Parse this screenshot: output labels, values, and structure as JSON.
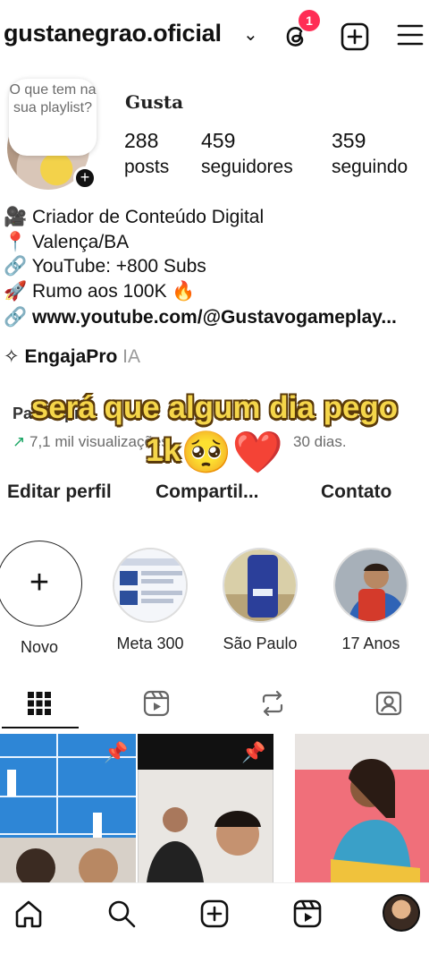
{
  "header": {
    "username": "gustanegrao.oficial",
    "notification_count": "1"
  },
  "profile": {
    "note": "O que tem na sua playlist?",
    "display_name": "Gusta",
    "stats": [
      {
        "value": "288",
        "label": "posts"
      },
      {
        "value": "459",
        "label": "seguidores"
      },
      {
        "value": "359",
        "label": "seguindo"
      }
    ],
    "bio": [
      "🎥 Criador de Conteúdo Digital",
      "📍 Valença/BA",
      "🔗 YouTube: +800 Subs",
      "🚀 Rumo aos 100K 🔥"
    ],
    "link": "www.youtube.com/@Gustavogameplay...",
    "app_name": "EngajaPro",
    "app_tag": "IA"
  },
  "dashboard": {
    "title": "Painel pro",
    "views": "7,1 mil visualizações",
    "period": "30 dias."
  },
  "caption": {
    "line1": "será que algum dia pego",
    "line2": "1k",
    "emoji": "🥺❤️"
  },
  "buttons": {
    "edit": "Editar perfil",
    "share": "Compartil...",
    "contact": "Contato"
  },
  "highlights": [
    {
      "label": "Novo"
    },
    {
      "label": "Meta 300"
    },
    {
      "label": "São Paulo"
    },
    {
      "label": "17 Anos"
    }
  ],
  "colors": {
    "badge": "#ff2d55",
    "caption_text": "#f5d64a"
  }
}
